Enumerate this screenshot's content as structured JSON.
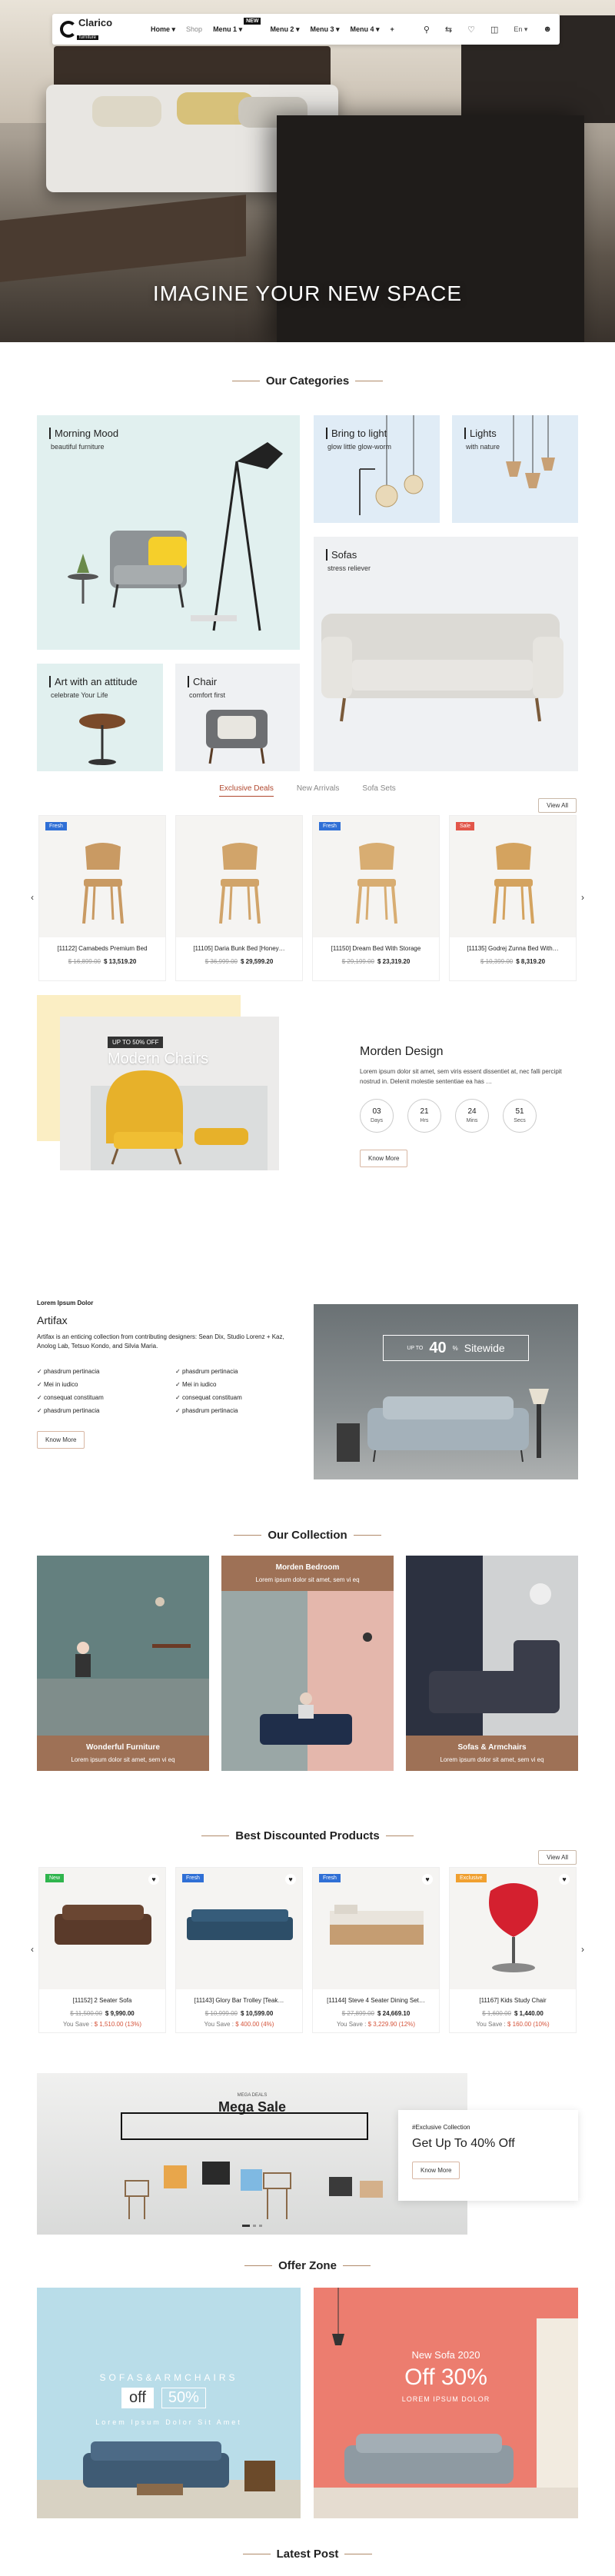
{
  "nav": {
    "logo": "Clarico",
    "logo_sub": "furniture",
    "menu": [
      {
        "label": "Home ▾",
        "muted": false
      },
      {
        "label": "Shop",
        "muted": true
      },
      {
        "label": "Menu 1 ▾",
        "muted": false,
        "badge": "NEW"
      },
      {
        "label": "Menu 2 ▾",
        "muted": false
      },
      {
        "label": "Menu 3 ▾",
        "muted": false
      },
      {
        "label": "Menu 4 ▾",
        "muted": false
      },
      {
        "label": "+",
        "muted": false
      }
    ],
    "lang": "En ▾"
  },
  "hero": {
    "tagline": "IMAGINE YOUR NEW SPACE"
  },
  "categories": {
    "title": "Our Categories",
    "items": [
      {
        "label": "Morning Mood",
        "sub": "beautiful furniture"
      },
      {
        "label": "Bring to light",
        "sub": "glow little glow-worm"
      },
      {
        "label": "Lights",
        "sub": "with nature"
      },
      {
        "label": "Sofas",
        "sub": "stress reliever"
      },
      {
        "label": "Art with an attitude",
        "sub": "celebrate Your Life"
      },
      {
        "label": "Chair",
        "sub": "comfort first"
      }
    ]
  },
  "deals": {
    "tabs": [
      "Exclusive Deals",
      "New Arrivals",
      "Sofa Sets"
    ],
    "view_all": "View All",
    "products": [
      {
        "name": "[11122] Camabeds Premium Bed",
        "old": "$ 16,899.00",
        "price": "$ 13,519.20",
        "tag": "Fresh"
      },
      {
        "name": "[11105] Daria Bunk Bed [Honey…",
        "old": "$ 36,999.00",
        "price": "$ 29,599.20",
        "tag": ""
      },
      {
        "name": "[11150] Dream Bed With Storage",
        "old": "$ 29,199.00",
        "price": "$ 23,319.20",
        "tag": "Fresh"
      },
      {
        "name": "[11135] Godrej Zunna Bed With…",
        "old": "$ 10,399.00",
        "price": "$ 8,319.20",
        "tag": "Sale"
      }
    ]
  },
  "morden": {
    "overlay_tag": "UP TO 50% OFF",
    "overlay_title": "Modern Chairs",
    "title": "Morden Design",
    "desc": "Lorem ipsum dolor sit amet, sem viris essent dissentiet at, nec falli percipit nostrud in. Delenit molestie sententiae ea has …",
    "countdown": [
      {
        "num": "03",
        "unit": "Days"
      },
      {
        "num": "21",
        "unit": "Hrs"
      },
      {
        "num": "24",
        "unit": "Mins"
      },
      {
        "num": "51",
        "unit": "Secs"
      }
    ],
    "button": "Know More"
  },
  "artifax": {
    "kicker": "Lorem Ipsum Dolor",
    "title": "Artifax",
    "desc": "Artifax is an enticing collection from contributing designers: Sean Dix, Studio Lorenz + Kaz, Anolog Lab, Tetsuo Kondo, and Silvia Maria.",
    "checks": [
      "phasdrum pertinacia",
      "phasdrum pertinacia",
      "Mei in iudico",
      "Mei in iudico",
      "consequat constituam",
      "consequat constituam",
      "phasdrum pertinacia",
      "phasdrum pertinacia"
    ],
    "button": "Know More",
    "banner_pre": "UP TO",
    "banner_num": "40",
    "banner_pct": "%",
    "banner_text": "Sitewide"
  },
  "collection": {
    "title": "Our Collection",
    "items": [
      {
        "title": "Wonderful Furniture",
        "sub": "Lorem ipsum dolor sit amet, sem vi eq"
      },
      {
        "title": "Morden Bedroom",
        "sub": "Lorem ipsum dolor sit amet, sem vi eq"
      },
      {
        "title": "Sofas & Armchairs",
        "sub": "Lorem ipsum dolor sit amet, sem vi eq"
      }
    ]
  },
  "discounted": {
    "title": "Best Discounted Products",
    "view_all": "View All",
    "products": [
      {
        "name": "[11152] 2 Seater Sofa",
        "old": "$ 11,500.00",
        "price": "$ 9,990.00",
        "save_label": "You Save :",
        "save": "$ 1,510.00 (13%)",
        "tag": "New"
      },
      {
        "name": "[11143] Glory Bar Trolley [Teak…",
        "old": "$ 10,999.00",
        "price": "$ 10,599.00",
        "save_label": "You Save :",
        "save": "$ 400.00 (4%)",
        "tag": "Fresh"
      },
      {
        "name": "[11144] Steve 4 Seater Dining Set…",
        "old": "$ 27,899.00",
        "price": "$ 24,669.10",
        "save_label": "You Save :",
        "save": "$ 3,229.90 (12%)",
        "tag": "Fresh"
      },
      {
        "name": "[11167] Kids Study Chair",
        "old": "$ 1,600.00",
        "price": "$ 1,440.00",
        "save_label": "You Save :",
        "save": "$ 160.00 (10%)",
        "tag": "Exclusive"
      }
    ]
  },
  "mega": {
    "kicker": "MEGA DEALS",
    "title": "Mega Sale",
    "card_kicker": "#Exclusive Collection",
    "card_title": "Get Up To 40% Off",
    "button": "Know More"
  },
  "offer": {
    "title": "Offer Zone",
    "left": {
      "top": "SOFAS&ARMCHAIRS",
      "off": "off",
      "pct": "50%",
      "sub": "Lorem Ipsum Dolor Sit Amet"
    },
    "right": {
      "top": "New Sofa 2020",
      "big": "Off 30%",
      "sub": "LOREM IPSUM DOLOR"
    }
  },
  "latest": {
    "title": "Latest Post"
  },
  "colors": {
    "accent": "#b0472e",
    "brown": "#9e7156",
    "mint": "#e1f0ef",
    "salmon": "#ec7d6f",
    "skyblue": "#b9dde9"
  }
}
